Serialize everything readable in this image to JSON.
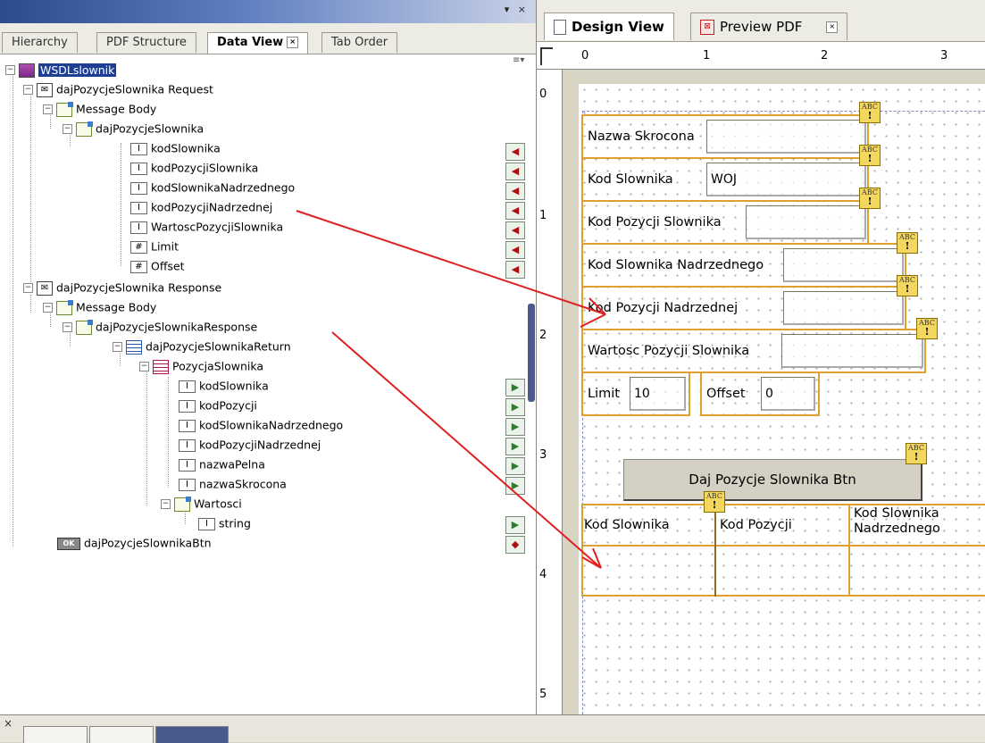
{
  "left_panel": {
    "tabs": [
      {
        "label": "Hierarchy"
      },
      {
        "label": "PDF Structure"
      },
      {
        "label": "Data View",
        "close": "×"
      },
      {
        "label": "Tab Order"
      }
    ],
    "window_controls": "▾ ×",
    "tree": {
      "root": "WSDLslownik",
      "request": "dajPozycjeSlownika Request",
      "request_body": "Message Body",
      "request_op": "dajPozycjeSlownika",
      "request_fields": [
        "kodSlownika",
        "kodPozycjiSlownika",
        "kodSlownikaNadrzednego",
        "kodPozycjiNadrzednej",
        "WartoscPozycjiSlownika",
        "Limit",
        "Offset"
      ],
      "response": "dajPozycjeSlownika Response",
      "response_body": "Message Body",
      "response_op": "dajPozycjeSlownikaResponse",
      "response_return": "dajPozycjeSlownikaReturn",
      "response_item": "PozycjaSlownika",
      "response_fields": [
        "kodSlownika",
        "kodPozycji",
        "kodSlownikaNadrzednego",
        "kodPozycjiNadrzednej",
        "nazwaPelna",
        "nazwaSkrocona"
      ],
      "response_wartosci": "Wartosci",
      "response_string": "string",
      "button": "dajPozycjeSlownikaBtn"
    }
  },
  "right_panel": {
    "tabs": [
      {
        "label": "Design View"
      },
      {
        "label": "Preview PDF",
        "close": "×"
      }
    ],
    "ruler_h": [
      "0",
      "1",
      "2",
      "3"
    ],
    "ruler_v": [
      "0",
      "1",
      "2",
      "3",
      "4",
      "5"
    ],
    "form": {
      "nazwa_skrocona": {
        "label": "Nazwa Skrocona",
        "value": ""
      },
      "kod_slownika": {
        "label": "Kod Slownika",
        "value": "WOJ"
      },
      "kod_pozycji_slownika": {
        "label": "Kod Pozycji Slownika",
        "value": ""
      },
      "kod_slownika_nadrzednego": {
        "label": "Kod Slownika Nadrzednego",
        "value": ""
      },
      "kod_pozycji_nadrzednej": {
        "label": "Kod Pozycji Nadrzednej",
        "value": ""
      },
      "wartosc_pozycji": {
        "label": "Wartosc Pozycji Slownika",
        "value": ""
      },
      "limit": {
        "label": "Limit",
        "value": "10"
      },
      "offset": {
        "label": "Offset",
        "value": "0"
      },
      "button_label": "Daj Pozycje Slownika Btn",
      "table_headers": [
        "Kod Slownika",
        "Kod Pozycji",
        "Kod Slownika Nadrzednego"
      ]
    },
    "abc_badge": {
      "top": "ABC",
      "bottom": "!"
    }
  },
  "colors": {
    "field_border": "#e0a030",
    "selection": "#1c3f95",
    "arrow": "#e02020"
  }
}
